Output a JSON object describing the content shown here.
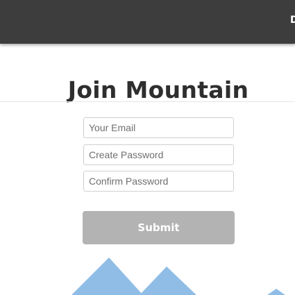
{
  "header": {
    "nav_link_label": "D"
  },
  "form": {
    "title": "Join Mountain",
    "email_placeholder": "Your Email",
    "password_placeholder": "Create Password",
    "confirm_placeholder": "Confirm Password",
    "submit_label": "Submit"
  },
  "colors": {
    "topbar": "#3d3d3d",
    "submit_button": "#b3b3b3",
    "mountains": "#8fbde6"
  }
}
